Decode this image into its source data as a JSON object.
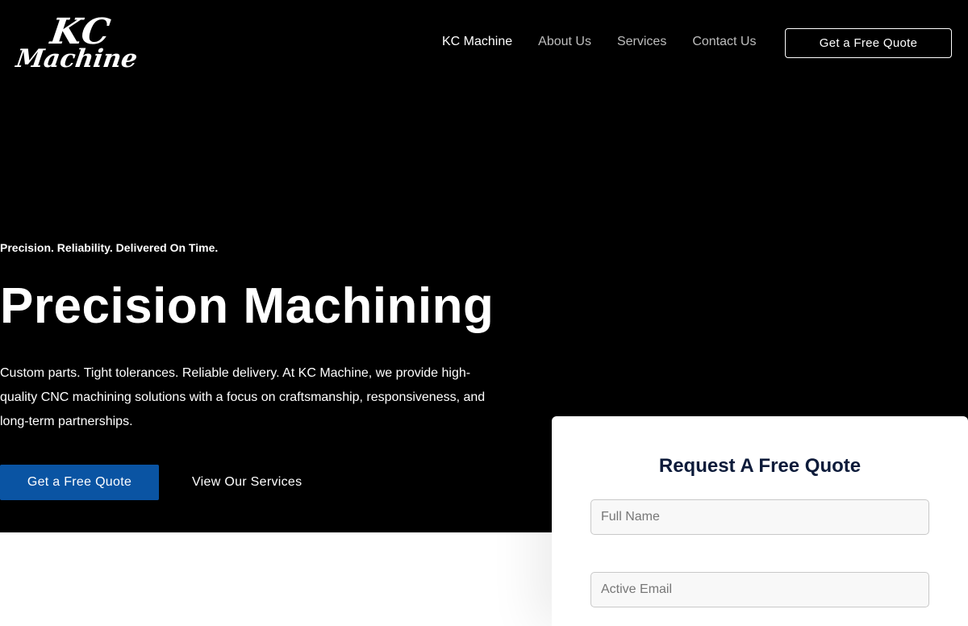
{
  "brand": {
    "logo_top": "KC",
    "logo_bottom": "Machine"
  },
  "nav": {
    "items": [
      {
        "label": "KC Machine"
      },
      {
        "label": "About Us"
      },
      {
        "label": "Services"
      },
      {
        "label": "Contact Us"
      }
    ],
    "cta_label": "Get a Free Quote"
  },
  "hero": {
    "tagline": "Precision. Reliability. Delivered On Time.",
    "headline": "Precision Machining",
    "description": "Custom parts. Tight tolerances. Reliable delivery. At KC Machine, we provide high-quality CNC machining solutions with a focus on craftsmanship, responsiveness, and long-term partnerships.",
    "primary_button": "Get a Free Quote",
    "secondary_button": "View Our Services"
  },
  "quote_form": {
    "title": "Request A Free Quote",
    "name_placeholder": "Full Name",
    "email_placeholder": "Active Email"
  },
  "colors": {
    "hero_background": "#000000",
    "primary_button": "#0a54a3",
    "form_title": "#0d1b3a"
  }
}
